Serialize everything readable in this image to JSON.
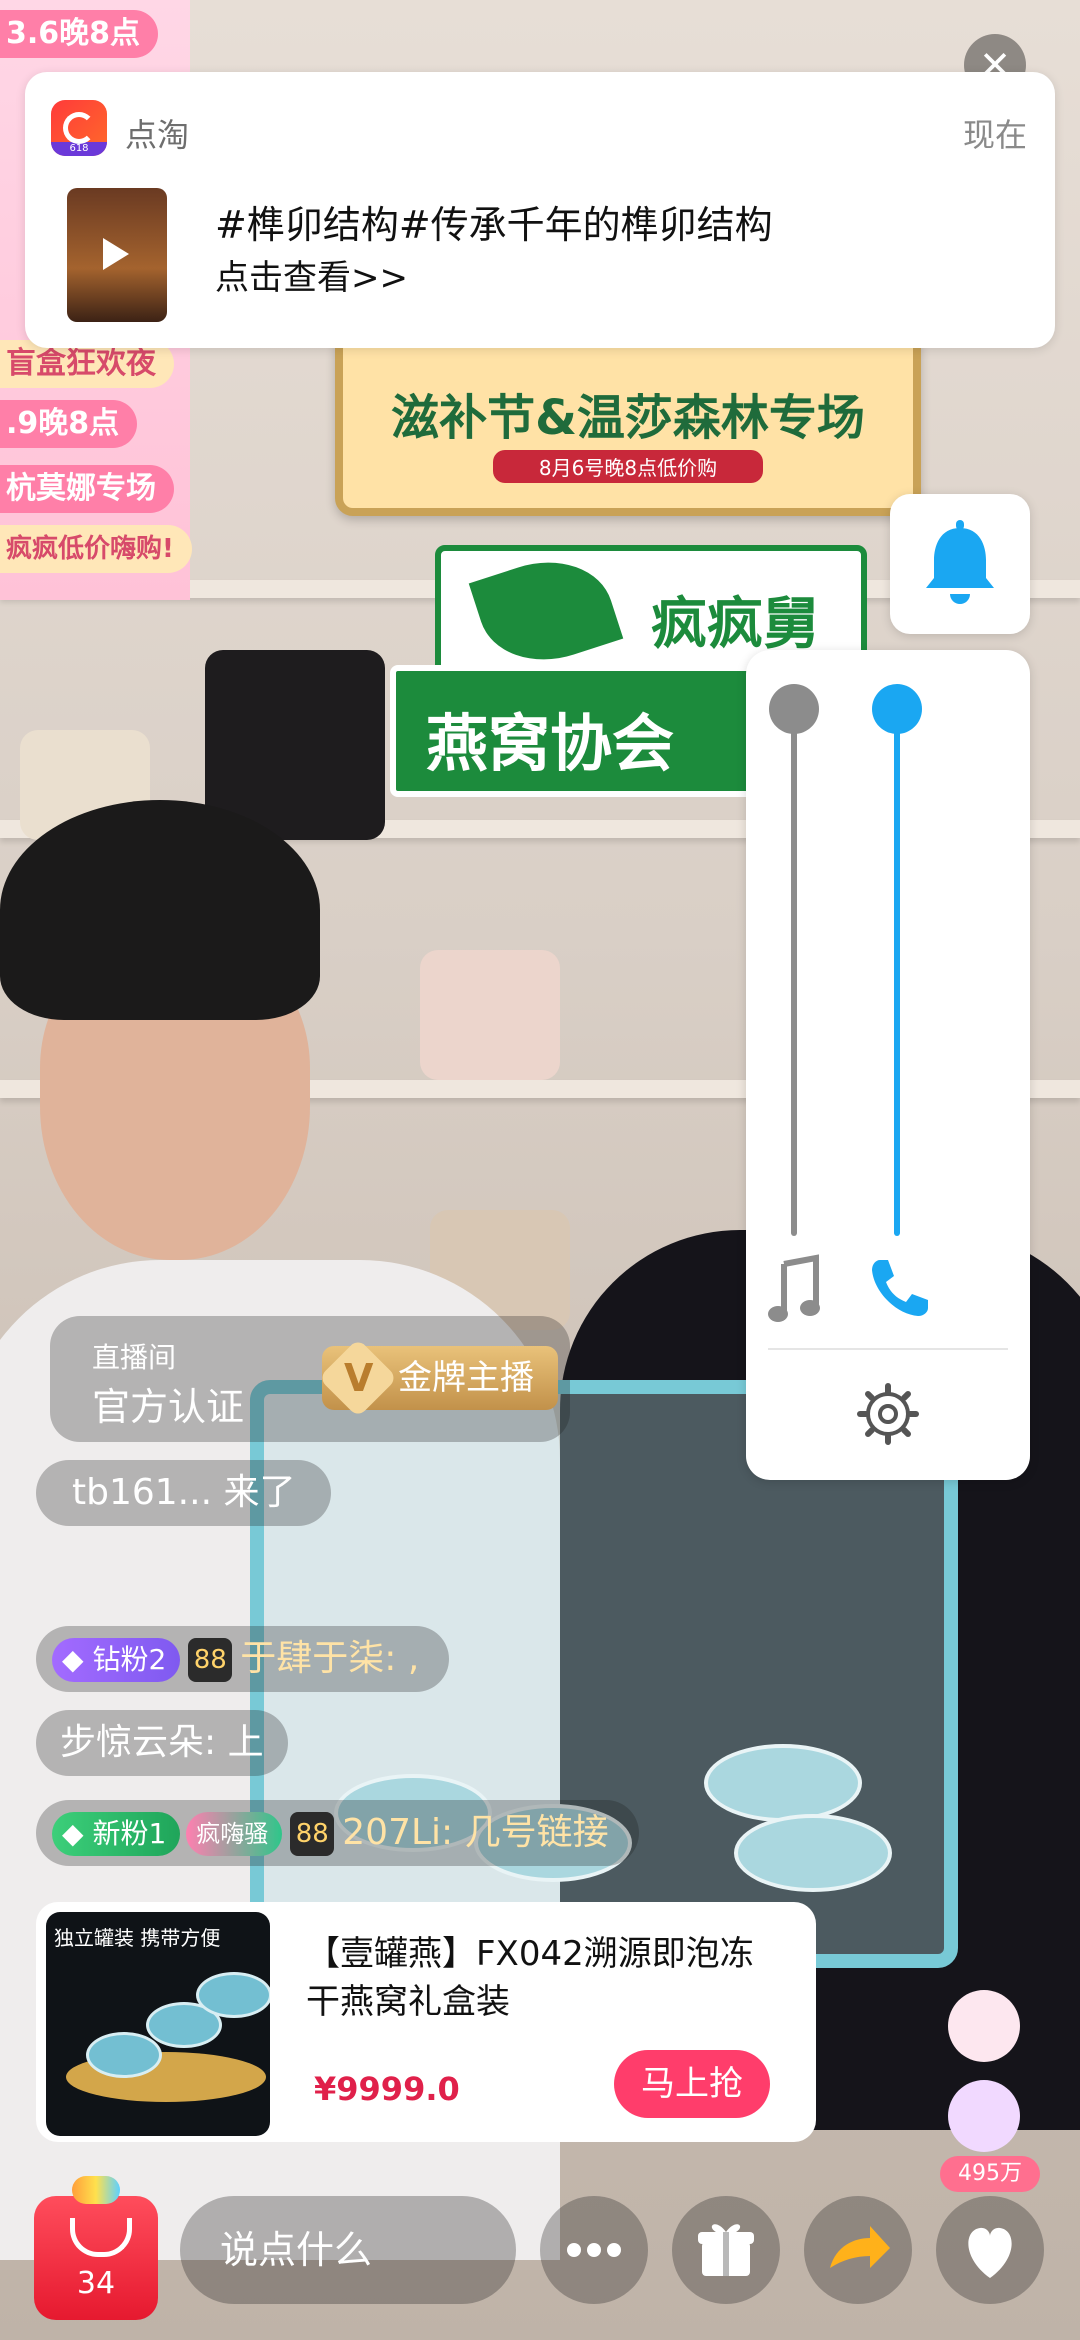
{
  "notification": {
    "app_name": "点淘",
    "app_badge": "618",
    "time": "现在",
    "title": "#榫卯结构#传承千年的榫卯结构",
    "subtitle": "点击查看>>"
  },
  "background": {
    "left_banner": [
      "3.6晚8点",
      "盲盒狂欢夜",
      ".9晚8点",
      "杭莫娜专场",
      "疯疯低价嗨购!"
    ],
    "promo_sign_main": "滋补节&温莎森林专场",
    "promo_sign_sub": "8月6号晚8点低价购",
    "brand_sign": "疯疯舅舅",
    "green_sign": "燕窝协会"
  },
  "anchor": {
    "line1": "直播间",
    "line2": "官方认证",
    "badge": "金牌主播",
    "badge_letter": "V"
  },
  "chat": [
    {
      "text": "tb161... 来了"
    },
    {
      "badge": "钻粉2",
      "level": "88",
      "text": "于肆于柒: ,"
    },
    {
      "text": "步惊云朵: 上"
    },
    {
      "badge": "新粉1",
      "badge2": "疯嗨骚",
      "level": "88",
      "text": "207Li: 几号链接"
    }
  ],
  "product": {
    "name": "【壹罐燕】FX042溯源即泡冻干燕窝礼盒装",
    "price": "¥9999.0",
    "buy_label": "马上抢",
    "image_tag": "独立罐装 携带方便"
  },
  "bottom": {
    "cart_count": "34",
    "say_placeholder": "说点什么",
    "likes": "495万"
  },
  "colors": {
    "accent_blue": "#1aa7f2",
    "buy_pink": "#ff3d6b",
    "price_red": "#e0204a"
  },
  "icons": {
    "bell": "bell-icon",
    "music": "music-note-icon",
    "call": "phone-icon",
    "settings": "gear-icon",
    "more": "more-icon",
    "gift": "gift-icon",
    "share": "share-icon",
    "like": "heart-icon"
  }
}
